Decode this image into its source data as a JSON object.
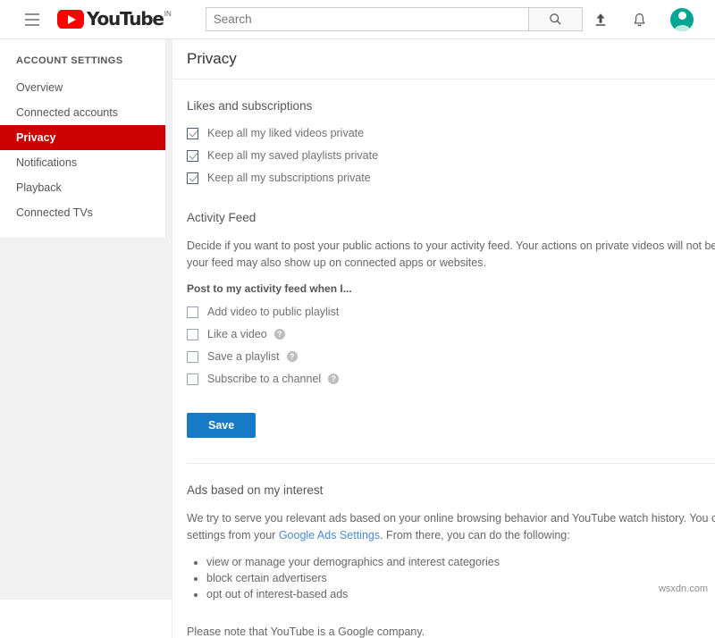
{
  "header": {
    "menu_icon": "hamburger-menu-icon",
    "logo_text": "YouTube",
    "logo_country": "IN",
    "search_placeholder": "Search",
    "search_value": "",
    "search_button_icon": "search-icon",
    "upload_icon": "upload-icon",
    "notifications_icon": "bell-icon",
    "avatar_icon": "user-avatar"
  },
  "sidebar": {
    "title": "ACCOUNT SETTINGS",
    "items": [
      {
        "label": "Overview",
        "active": false
      },
      {
        "label": "Connected accounts",
        "active": false
      },
      {
        "label": "Privacy",
        "active": true
      },
      {
        "label": "Notifications",
        "active": false
      },
      {
        "label": "Playback",
        "active": false
      },
      {
        "label": "Connected TVs",
        "active": false
      }
    ],
    "active_color": "#cc0000"
  },
  "main": {
    "page_title": "Privacy",
    "likes_section": {
      "title": "Likes and subscriptions",
      "options": [
        {
          "label": "Keep all my liked videos private",
          "checked": true
        },
        {
          "label": "Keep all my saved playlists private",
          "checked": true
        },
        {
          "label": "Keep all my subscriptions private",
          "checked": true
        }
      ]
    },
    "activity_section": {
      "title": "Activity Feed",
      "description_line1": "Decide if you want to post your public actions to your activity feed. Your actions on private videos will not be posted. Your",
      "description_line2": "your feed may also show up on connected apps or websites.",
      "subheading": "Post to my activity feed when I...",
      "options": [
        {
          "label": "Add video to public playlist",
          "checked": false,
          "help": false
        },
        {
          "label": "Like a video",
          "checked": false,
          "help": true
        },
        {
          "label": "Save a playlist",
          "checked": false,
          "help": true
        },
        {
          "label": "Subscribe to a channel",
          "checked": false,
          "help": true
        }
      ],
      "help_glyph": "?",
      "save_label": "Save",
      "save_color": "#167ac6"
    },
    "ads_section": {
      "title": "Ads based on my interest",
      "paragraph_pre": "We try to serve you relevant ads based on your online browsing behavior and YouTube watch history. You can manage yo",
      "paragraph_line2_pre": "settings from your ",
      "link_text": "Google Ads Settings",
      "paragraph_line2_post": ". From there, you can do the following:",
      "bullets": [
        "view or manage your demographics and interest categories",
        "block certain advertisers",
        "opt out of interest-based ads"
      ],
      "note": "Please note that YouTube is a Google company.",
      "link_color": "#4a8bd4"
    }
  },
  "watermark": "wsxdn.com"
}
